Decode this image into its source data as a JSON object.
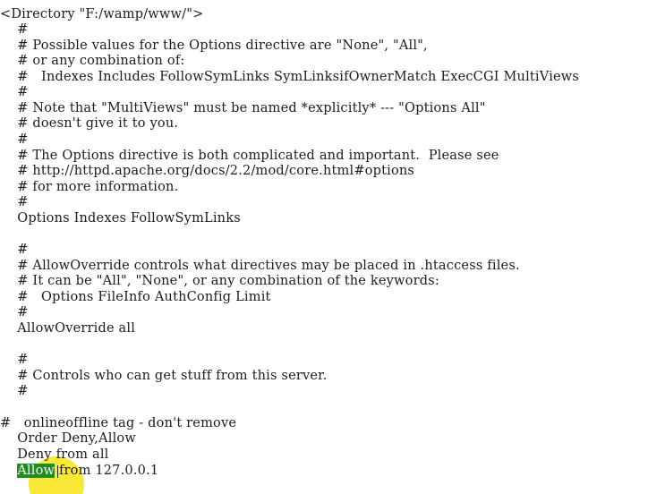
{
  "editor": {
    "lines": [
      "\"",
      "<Directory \"F:/wamp/www/\">",
      "    #",
      "    # Possible values for the Options directive are \"None\", \"All\",",
      "    # or any combination of:",
      "    #   Indexes Includes FollowSymLinks SymLinksifOwnerMatch ExecCGI MultiViews",
      "    #",
      "    # Note that \"MultiViews\" must be named *explicitly* --- \"Options All\"",
      "    # doesn't give it to you.",
      "    #",
      "    # The Options directive is both complicated and important.  Please see",
      "    # http://httpd.apache.org/docs/2.2/mod/core.html#options",
      "    # for more information.",
      "    #",
      "    Options Indexes FollowSymLinks",
      "",
      "    #",
      "    # AllowOverride controls what directives may be placed in .htaccess files.",
      "    # It can be \"All\", \"None\", or any combination of the keywords:",
      "    #   Options FileInfo AuthConfig Limit",
      "    #",
      "    AllowOverride all",
      "",
      "    #",
      "    # Controls who can get stuff from this server.",
      "    #",
      "",
      "#   onlineoffline tag - don't remove",
      "    Order Deny,Allow",
      "    Deny from all"
    ],
    "selected_word": "Allow",
    "last_line_rest": " from 127.0.0.1",
    "last_line_indent": "    "
  },
  "highlight_color": "#fae628",
  "selection_color": "#228b22"
}
